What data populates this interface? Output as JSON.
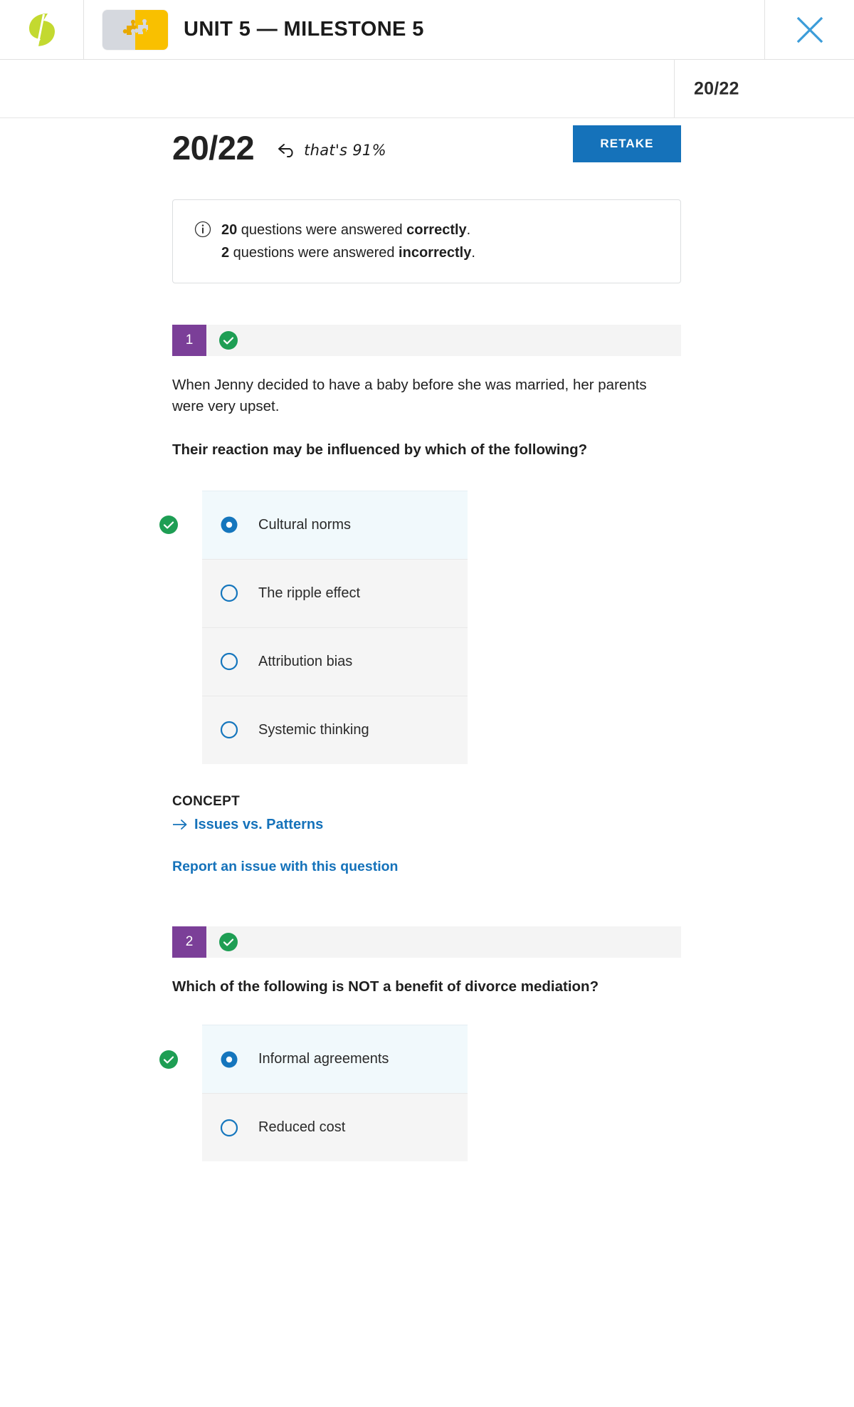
{
  "header": {
    "logo_icon": "sophia-leaf-logo",
    "course_thumb_icon": "puzzle-piece-thumbnail",
    "unit_title": "UNIT 5 — MILESTONE 5",
    "close_icon": "close-icon"
  },
  "subbar": {
    "score": "20/22"
  },
  "results": {
    "score": "20/22",
    "percent_note": "that's 91%",
    "percent_arrow_icon": "curved-arrow-icon",
    "retake_label": "RETAKE",
    "info_icon": "info-circle-icon",
    "summary": {
      "correct_count": "20",
      "correct_text_mid": " questions were answered ",
      "correct_word": "correctly",
      "correct_period": ".",
      "incorrect_count": "2",
      "incorrect_text_mid": " questions were answered ",
      "incorrect_word": "incorrectly",
      "incorrect_period": "."
    }
  },
  "questions": [
    {
      "number": "1",
      "status_icon": "green-check-circle-icon",
      "body": "When Jenny decided to have a baby before she was married, her parents were very upset.",
      "prompt": "Their reaction may be influenced by which of the following?",
      "options": [
        {
          "label": "Cultural norms",
          "selected": true,
          "correct": true
        },
        {
          "label": "The ripple effect",
          "selected": false,
          "correct": false
        },
        {
          "label": "Attribution bias",
          "selected": false,
          "correct": false
        },
        {
          "label": "Systemic thinking",
          "selected": false,
          "correct": false
        }
      ],
      "concept_label": "CONCEPT",
      "concept_link": "Issues vs. Patterns",
      "report_link": "Report an issue with this question"
    },
    {
      "number": "2",
      "status_icon": "green-check-circle-icon",
      "prompt_pre": "Which of the following is ",
      "prompt_bold": "NOT",
      "prompt_post": " a benefit of divorce mediation?",
      "options": [
        {
          "label": "Informal agreements",
          "selected": true,
          "correct": true
        },
        {
          "label": "Reduced cost",
          "selected": false,
          "correct": false
        }
      ]
    }
  ],
  "colors": {
    "accent_blue": "#1572ba",
    "badge_purple": "#7b3f98",
    "success_green": "#1e9e54",
    "brand_green": "#c3d930",
    "thumb_yellow": "#f9c000"
  }
}
